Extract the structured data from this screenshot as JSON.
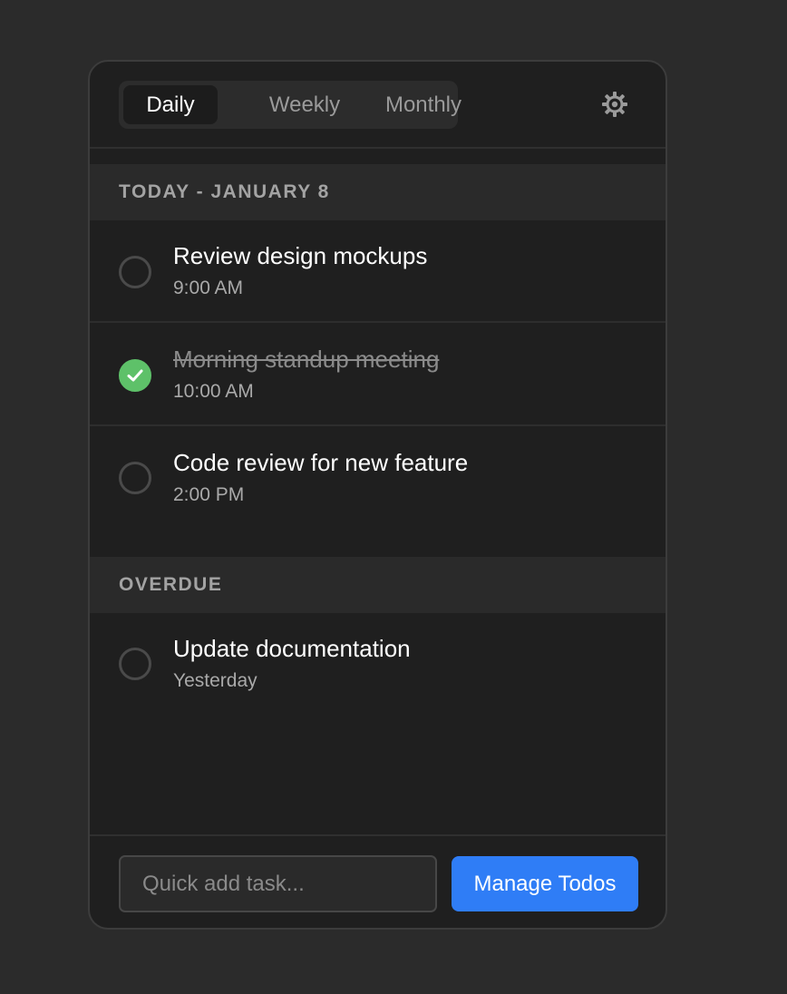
{
  "tabs": [
    {
      "label": "Daily",
      "active": true
    },
    {
      "label": "Weekly",
      "active": false
    },
    {
      "label": "Monthly",
      "active": false
    }
  ],
  "settings_icon": "gear-icon",
  "sections": [
    {
      "heading": "TODAY - JANUARY 8",
      "tasks": [
        {
          "title": "Review design mockups",
          "time": "9:00 AM",
          "done": false
        },
        {
          "title": "Morning standup meeting",
          "time": "10:00 AM",
          "done": true
        },
        {
          "title": "Code review for new feature",
          "time": "2:00 PM",
          "done": false
        }
      ]
    },
    {
      "heading": "OVERDUE",
      "tasks": [
        {
          "title": "Update documentation",
          "time": "Yesterday",
          "done": false
        }
      ]
    }
  ],
  "footer": {
    "quick_add_placeholder": "Quick add task...",
    "manage_label": "Manage Todos"
  },
  "colors": {
    "accent": "#2f7df6",
    "done": "#5ec169",
    "background": "#1f1f1f"
  }
}
